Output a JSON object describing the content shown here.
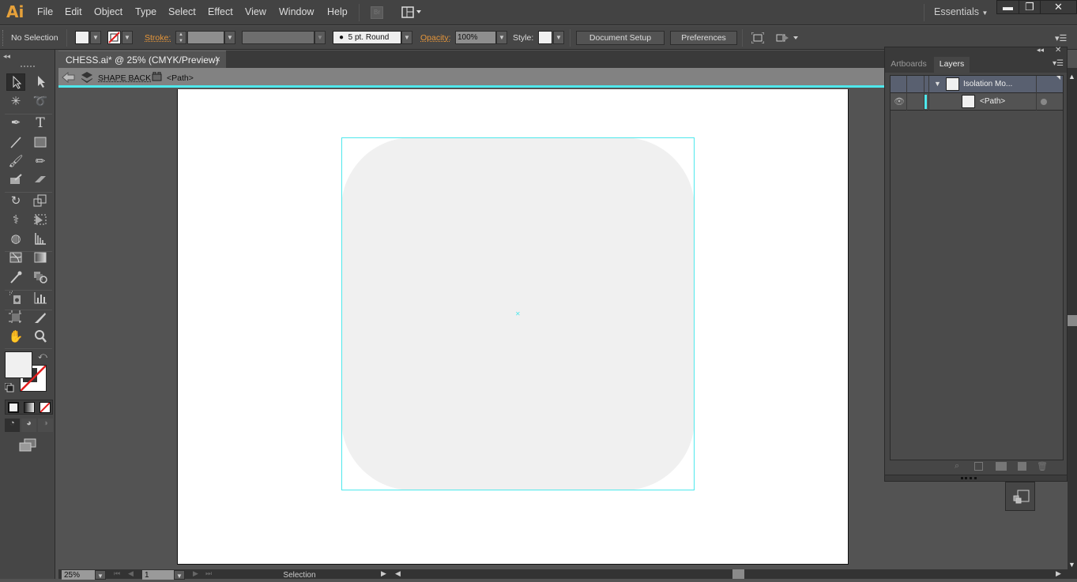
{
  "app": {
    "logo": "Ai",
    "workspace": "Essentials"
  },
  "menu": [
    "File",
    "Edit",
    "Object",
    "Type",
    "Select",
    "Effect",
    "View",
    "Window",
    "Help"
  ],
  "bridge_label": "Br",
  "window_controls": {
    "minimize": "▬",
    "restore": "❐",
    "close": "✕"
  },
  "control_bar": {
    "selection_status": "No Selection",
    "stroke_label": "Stroke:",
    "brush_label": "5 pt. Round",
    "opacity_label": "Opacity:",
    "opacity_value": "100%",
    "style_label": "Style:",
    "document_setup": "Document Setup",
    "preferences": "Preferences"
  },
  "document": {
    "tab_title": "CHESS.ai* @ 25% (CMYK/Preview)",
    "tab_close": "×",
    "breadcrumb": [
      {
        "label": "SHAPE BACK"
      },
      {
        "label": "<Path>"
      }
    ]
  },
  "layers_panel": {
    "tabs": [
      "Artboards",
      "Layers"
    ],
    "active_tab": "Layers",
    "rows": [
      {
        "name": "Isolation Mo...",
        "expanded": true,
        "visible": false
      },
      {
        "name": "<Path>",
        "visible": true,
        "color": "#4ee8ec"
      }
    ]
  },
  "status_bar": {
    "zoom": "25%",
    "artboard_number": "1",
    "current_tool": "Selection"
  },
  "colors": {
    "accent": "#4ee8ec",
    "logo": "#e6a13a",
    "orange_label": "#e6963a",
    "fill": "#f0f0f0"
  }
}
